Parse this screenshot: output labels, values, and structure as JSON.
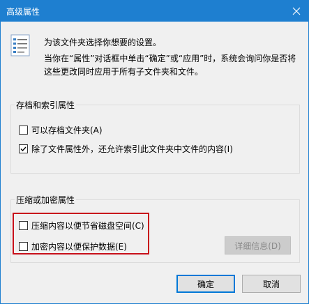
{
  "window": {
    "title": "高级属性"
  },
  "intro": {
    "line1": "为该文件夹选择你想要的设置。",
    "line2": "当你在“属性”对话框中单击“确定”或“应用”时，系统会询问你是否将这些更改同时应用于所有子文件夹和文件。"
  },
  "archive_index": {
    "title": "存档和索引属性",
    "options": [
      {
        "label": "可以存档文件夹(A)",
        "checked": false
      },
      {
        "label": "除了文件属性外，还允许索引此文件夹中文件的内容(I)",
        "checked": true
      }
    ]
  },
  "compress_encrypt": {
    "title": "压缩或加密属性",
    "options": [
      {
        "label": "压缩内容以便节省磁盘空间(C)",
        "checked": false
      },
      {
        "label": "加密内容以便保护数据(E)",
        "checked": false
      }
    ],
    "details_button": "详细信息(D)"
  },
  "buttons": {
    "ok": "确定",
    "cancel": "取消"
  },
  "colors": {
    "titlebar": "#1e7fd0",
    "highlight": "#c8101a",
    "primary_border": "#0078d7"
  }
}
